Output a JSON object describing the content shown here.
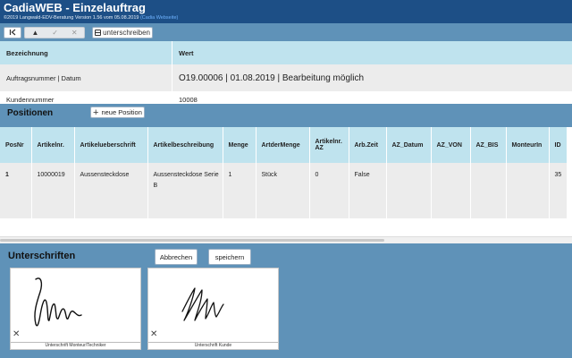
{
  "header": {
    "title": "CadiaWEB - Einzelauftrag",
    "subtitle": "©2019 Langwald-EDV-Beratung Version 1.56 vom 05.08.2019",
    "link": "(Cadia Webseite)"
  },
  "toolbar": {
    "first_icon": "first-page-icon",
    "sign_label": "unterschreiben"
  },
  "details": {
    "col_label": "Bezeichnung",
    "col_value": "Wert",
    "rows": [
      {
        "label": "Auftragsnummer | Datum",
        "value": "O19.00006 | 01.08.2019 | Bearbeitung möglich"
      },
      {
        "label": "Kundennummer",
        "value": "10008"
      }
    ]
  },
  "positionen": {
    "title": "Positionen",
    "add_label": "neue Position",
    "columns": [
      "PosNr",
      "Artikelnr.",
      "Artikelueberschrift",
      "Artikelbeschreibung",
      "Menge",
      "ArtderMenge",
      "Artikelnr. AZ",
      "Arb.Zeit",
      "AZ_Datum",
      "AZ_VON",
      "AZ_BIS",
      "MonteurIn",
      "ID"
    ],
    "rows": [
      [
        "1",
        "10000019",
        "Aussensteckdose",
        "Aussensteckdose Serie B",
        "1",
        "Stück",
        "0",
        "False",
        "",
        "",
        "",
        "",
        "35"
      ]
    ]
  },
  "signatures": {
    "title": "Unterschriften",
    "cancel_label": "Abbrechen",
    "save_label": "speichern",
    "box1_caption": "Unterschrift Monteur/Techniker",
    "box2_caption": "Unterschrift Kunde",
    "clear_icon": "clear-x-icon"
  },
  "colors": {
    "header_bg": "#1d4f86",
    "panel_bg": "#5f92b8",
    "table_head_bg": "#bfe3ee",
    "row_bg": "#ececec"
  }
}
